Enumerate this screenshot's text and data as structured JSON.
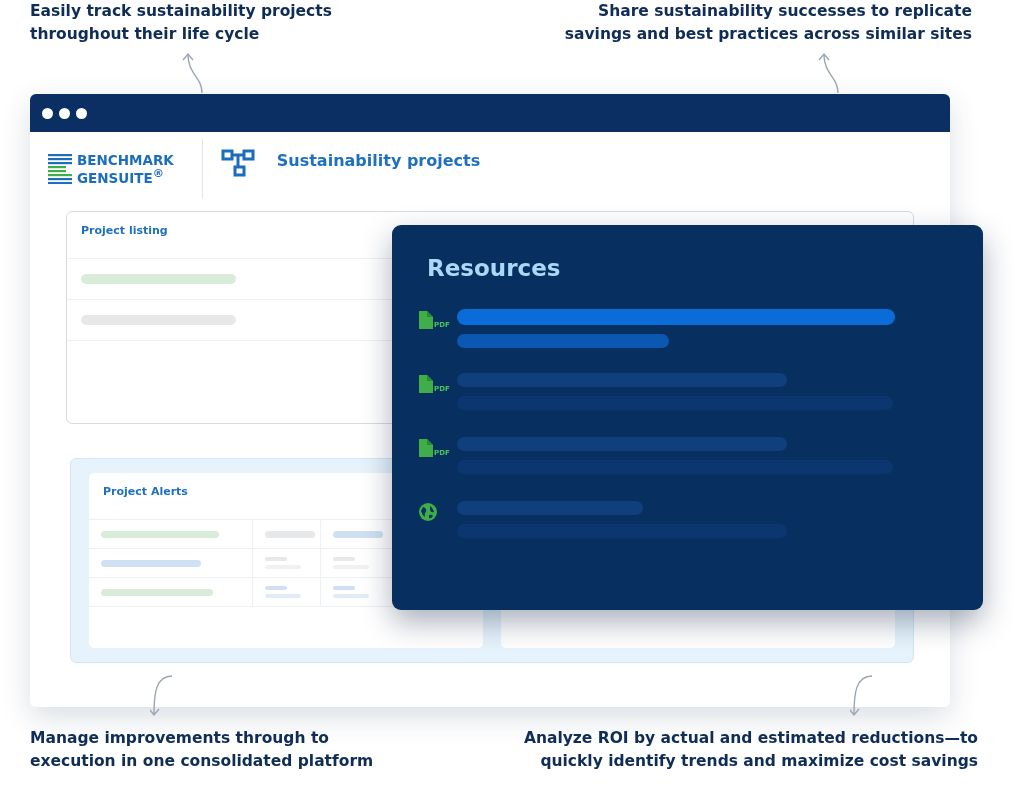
{
  "callouts_top": [
    {
      "text": "Easily track sustainability projects\nthroughout their life cycle"
    },
    {
      "text": "Share sustainability successes to replicate\nsavings and best practices across similar sites"
    }
  ],
  "logo": {
    "line_1": "BENCHMARK",
    "line_2": "GENSUITE$^{®}$"
  },
  "page_title": "Sustainability projects",
  "project_listing": {
    "title": "Project listing",
    "rows": [
      {
        "color": "#d9ecd9"
      },
      {
        "color": "#e6e8ea"
      }
    ]
  },
  "project_alerts": {
    "title": "Project Alerts",
    "rows": [
      {
        "cells": [
          {
            "kind": "bar",
            "color": "#d9ecd9"
          },
          {
            "kind": "bar",
            "color": "#e6e8ea"
          },
          {
            "kind": "bar",
            "color": "#cfe0f3"
          }
        ]
      },
      {
        "cells": [
          {
            "kind": "bar",
            "color": "#cfe0f3"
          },
          {
            "kind": "pair",
            "color": "#e6e8ea"
          },
          {
            "kind": "pair",
            "color": "#e6e8ea"
          }
        ]
      },
      {
        "cells": [
          {
            "kind": "bar",
            "color": "#d9ecd9"
          },
          {
            "kind": "pair",
            "color": "#cfe0f3"
          },
          {
            "kind": "pair",
            "color": "#cfe0f3"
          }
        ]
      }
    ]
  },
  "resources": {
    "title": "Resources",
    "items": [
      {
        "kind": "pdf",
        "tag": "PDF",
        "selected": true
      },
      {
        "kind": "pdf",
        "tag": "PDF",
        "selected": false
      },
      {
        "kind": "pdf",
        "tag": "PDF",
        "selected": false
      },
      {
        "kind": "globe",
        "selected": false
      }
    ]
  },
  "callouts_bottom": [
    {
      "text": "Manage improvements through to\nexecution in one consolidated platform"
    },
    {
      "text": "Analyze ROI by actual and estimated reductions—to\nquickly identify trends and maximize cost savings"
    }
  ]
}
